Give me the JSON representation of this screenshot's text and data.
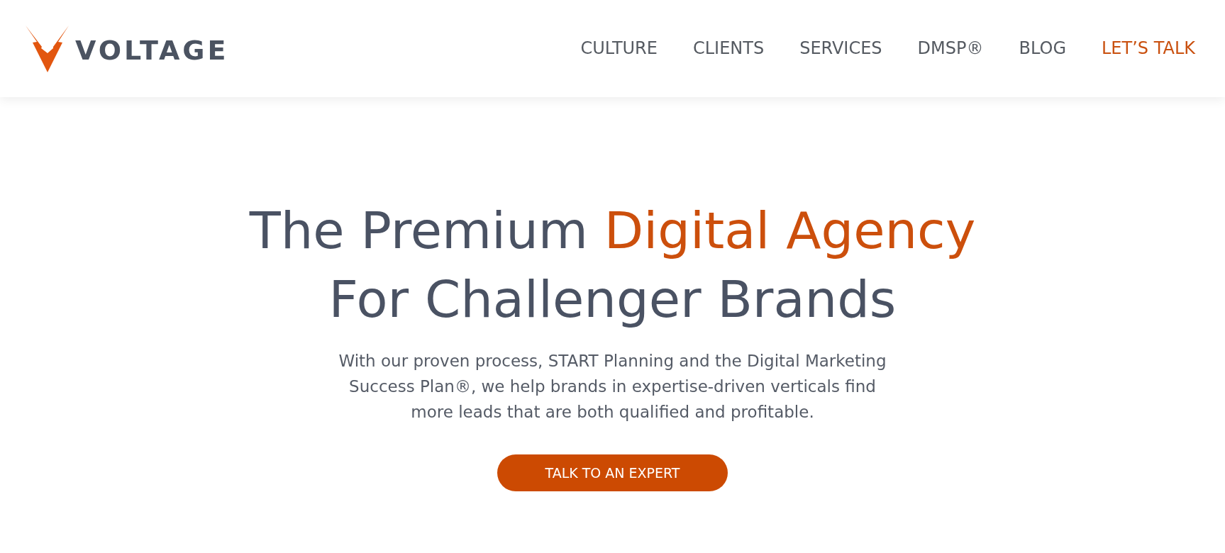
{
  "header": {
    "logo": {
      "wordmark": "VOLTAGE"
    },
    "nav": [
      {
        "label": "CULTURE",
        "kind": "link"
      },
      {
        "label": "CLIENTS",
        "kind": "link"
      },
      {
        "label": "SERVICES",
        "kind": "link"
      },
      {
        "label": "DMSP®",
        "kind": "link"
      },
      {
        "label": "BLOG",
        "kind": "link"
      },
      {
        "label": "LET’S TALK",
        "kind": "cta"
      }
    ]
  },
  "hero": {
    "headline": {
      "lines": [
        {
          "segments": [
            {
              "text": "The Premium ",
              "accent": false
            },
            {
              "text": "Digital Agency",
              "accent": true
            }
          ]
        },
        {
          "segments": [
            {
              "text": "For Challenger Brands",
              "accent": false
            }
          ]
        }
      ]
    },
    "description": {
      "lines": [
        "With our proven process, START Planning and the Digital Marketing",
        "Success Plan®, we help brands in expertise-driven verticals find",
        "more leads that are both qualified and profitable."
      ]
    },
    "button": {
      "label": "TALK TO AN EXPERT"
    }
  }
}
